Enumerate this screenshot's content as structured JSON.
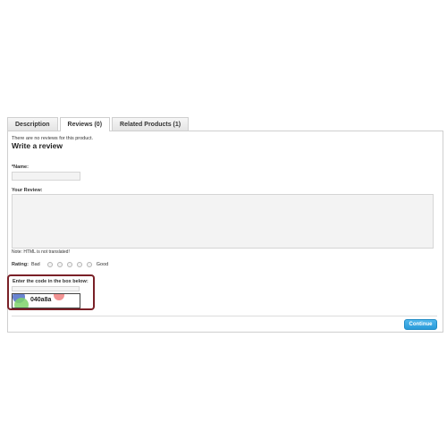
{
  "tabs": [
    {
      "label": "Description",
      "active": false
    },
    {
      "label": "Reviews (0)",
      "active": true
    },
    {
      "label": "Related Products (1)",
      "active": false
    }
  ],
  "review": {
    "no_reviews_text": "There are no reviews for this product.",
    "title": "Write a review",
    "name_label": "*Name:",
    "name_value": "",
    "review_label": "Your Review:",
    "review_value": "",
    "note": "Note: HTML is not translated!",
    "rating_label": "Rating:",
    "rating_bad": "Bad",
    "rating_good": "Good",
    "rating_options": 5
  },
  "captcha": {
    "label": "Enter the code in the box below:",
    "input_value": "",
    "code": "040a8a",
    "highlight_color": "#7a2027"
  },
  "actions": {
    "continue_label": "Continue",
    "button_color": "#2a9bd9"
  }
}
